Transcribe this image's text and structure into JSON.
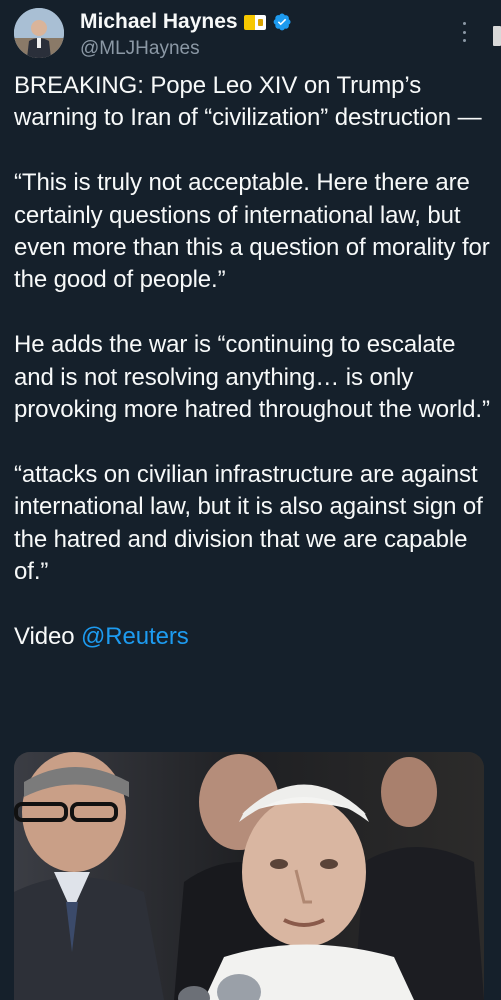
{
  "author": {
    "display_name": "Michael Haynes",
    "handle": "@MLJHaynes",
    "flag_icon": "vatican-flag-icon",
    "verified_icon": "verified-badge-icon",
    "verified_color": "#1d9bf0"
  },
  "tweet": {
    "paragraphs": [
      "BREAKING: Pope Leo XIV on Trump’s warning to Iran of “civilization” destruction —",
      "“This is truly not acceptable. Here there are certainly questions of international law, but even more than this a question of morality for the good of people.”",
      "He adds the war is “continuing to escalate and is not resolving anything… is only provoking more hatred throughout the world.”",
      "“attacks on civilian infrastructure are against international law, but it is also against sign of the hatred and division that we are capable of.”"
    ],
    "video_prefix": "Video",
    "mention": "@Reuters"
  },
  "colors": {
    "background": "#15202b",
    "text": "#f7f9f9",
    "secondary": "#8b98a5",
    "link": "#1d9bf0"
  }
}
